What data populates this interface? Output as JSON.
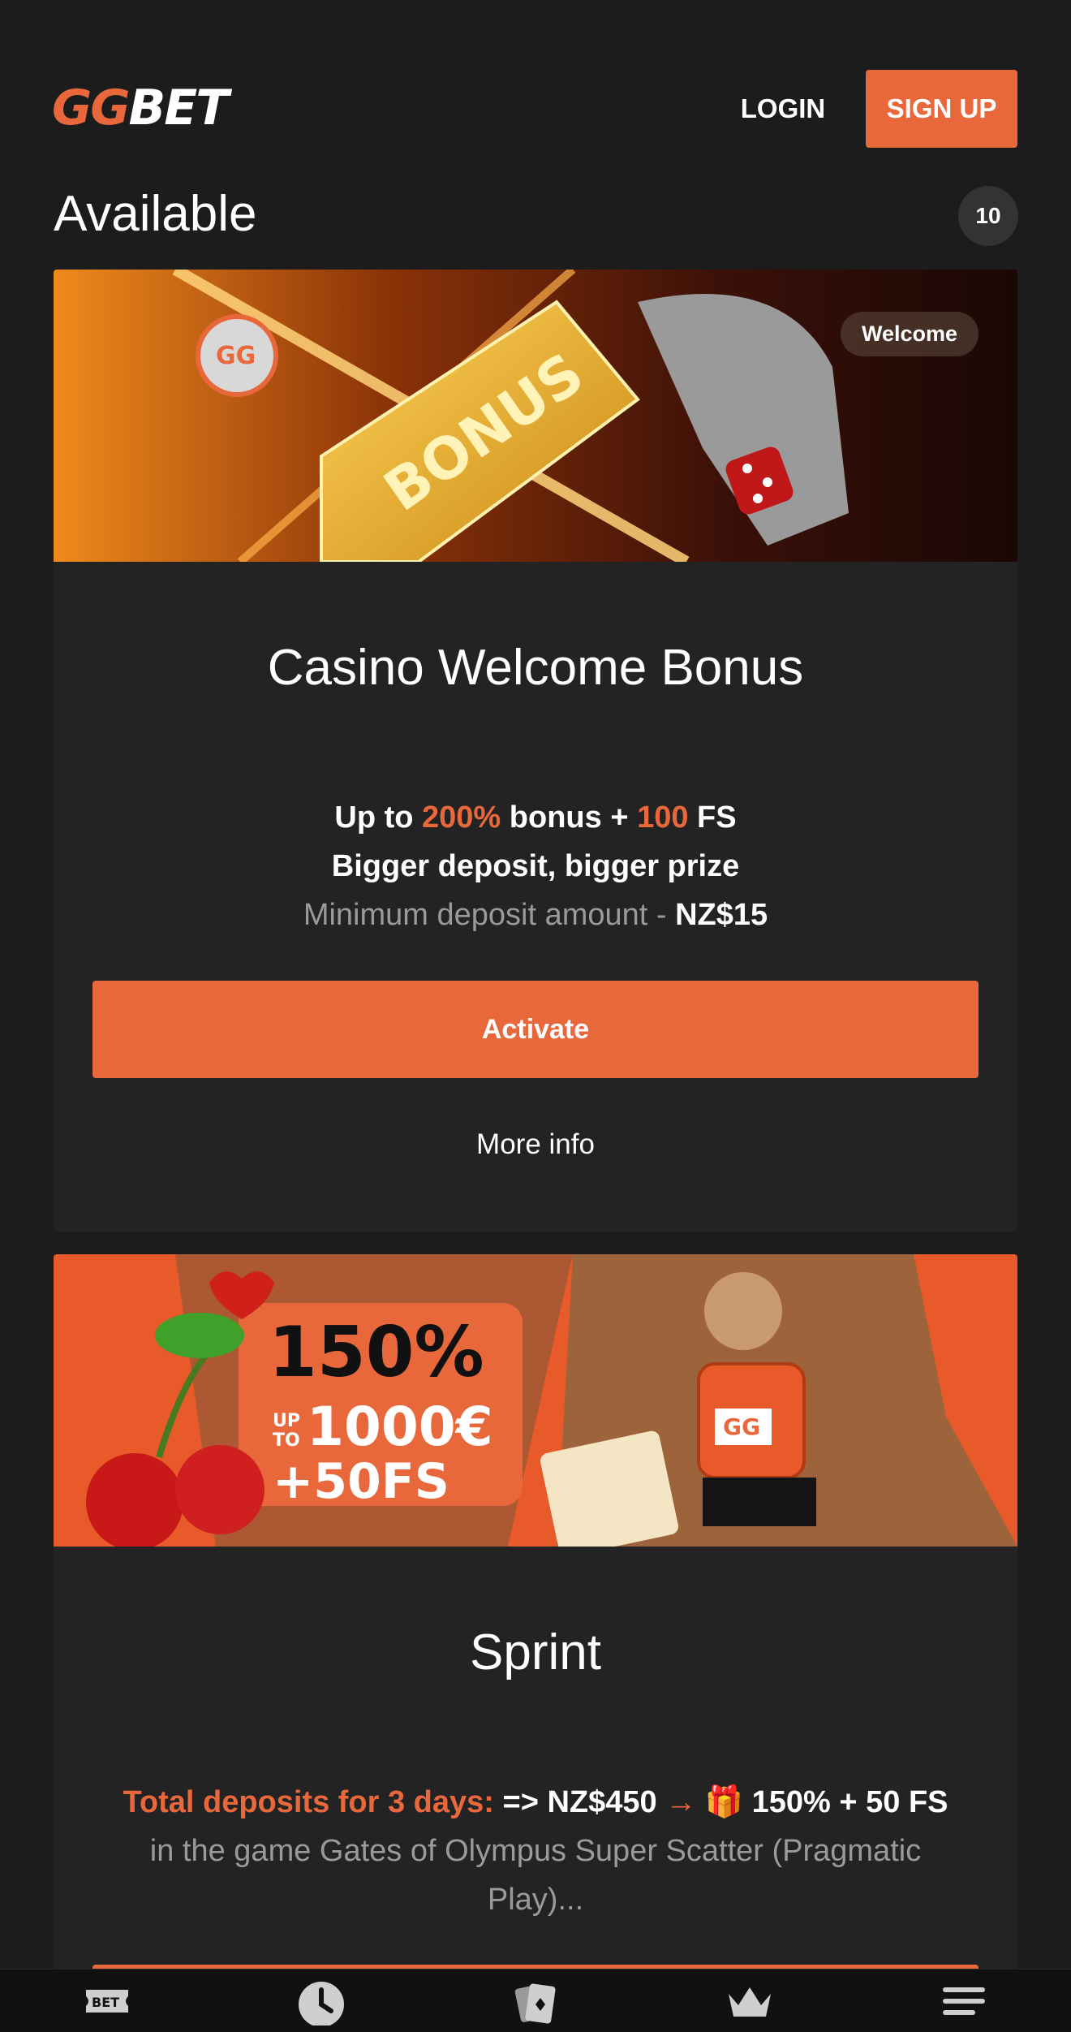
{
  "header": {
    "logo_gg": "GG",
    "logo_bet": "BET",
    "login_label": "LOGIN",
    "signup_label": "SIGN UP"
  },
  "section": {
    "title": "Available",
    "count": "10"
  },
  "cards": [
    {
      "tag": "Welcome",
      "banner_text": "WELCOME BONUS",
      "title": "Casino Welcome Bonus",
      "line1": {
        "a": "Up to ",
        "b": "200%",
        "c": " bonus + ",
        "d": "100",
        "e": " FS"
      },
      "line2": "Bigger deposit, bigger prize",
      "line3": {
        "a": "Minimum deposit amount - ",
        "b": "NZ$15"
      },
      "activate_label": "Activate",
      "more_info_label": "More info"
    },
    {
      "banner_text": {
        "big": "150%",
        "up": "UP",
        "to": "TO",
        "amount": "1000€",
        "fs": "+50FS",
        "jersey": "GG"
      },
      "title": "Sprint",
      "line1": {
        "a": "Total deposits for 3 days:",
        "b": " => NZ$450 ",
        "arrow": "→",
        "gift": "🎁",
        "c": " 150% + 50 FS"
      },
      "line2": "in the game Gates of Olympus Super Scatter (Pragmatic",
      "line3": "Play)..."
    }
  ],
  "bottom_nav": {
    "items": [
      "bet-icon",
      "clock-icon",
      "cards-icon",
      "crown-icon",
      "menu-icon"
    ],
    "bet_label": "BET"
  },
  "colors": {
    "accent": "#e8683c",
    "background": "#1c1c1c",
    "card": "#232323"
  }
}
